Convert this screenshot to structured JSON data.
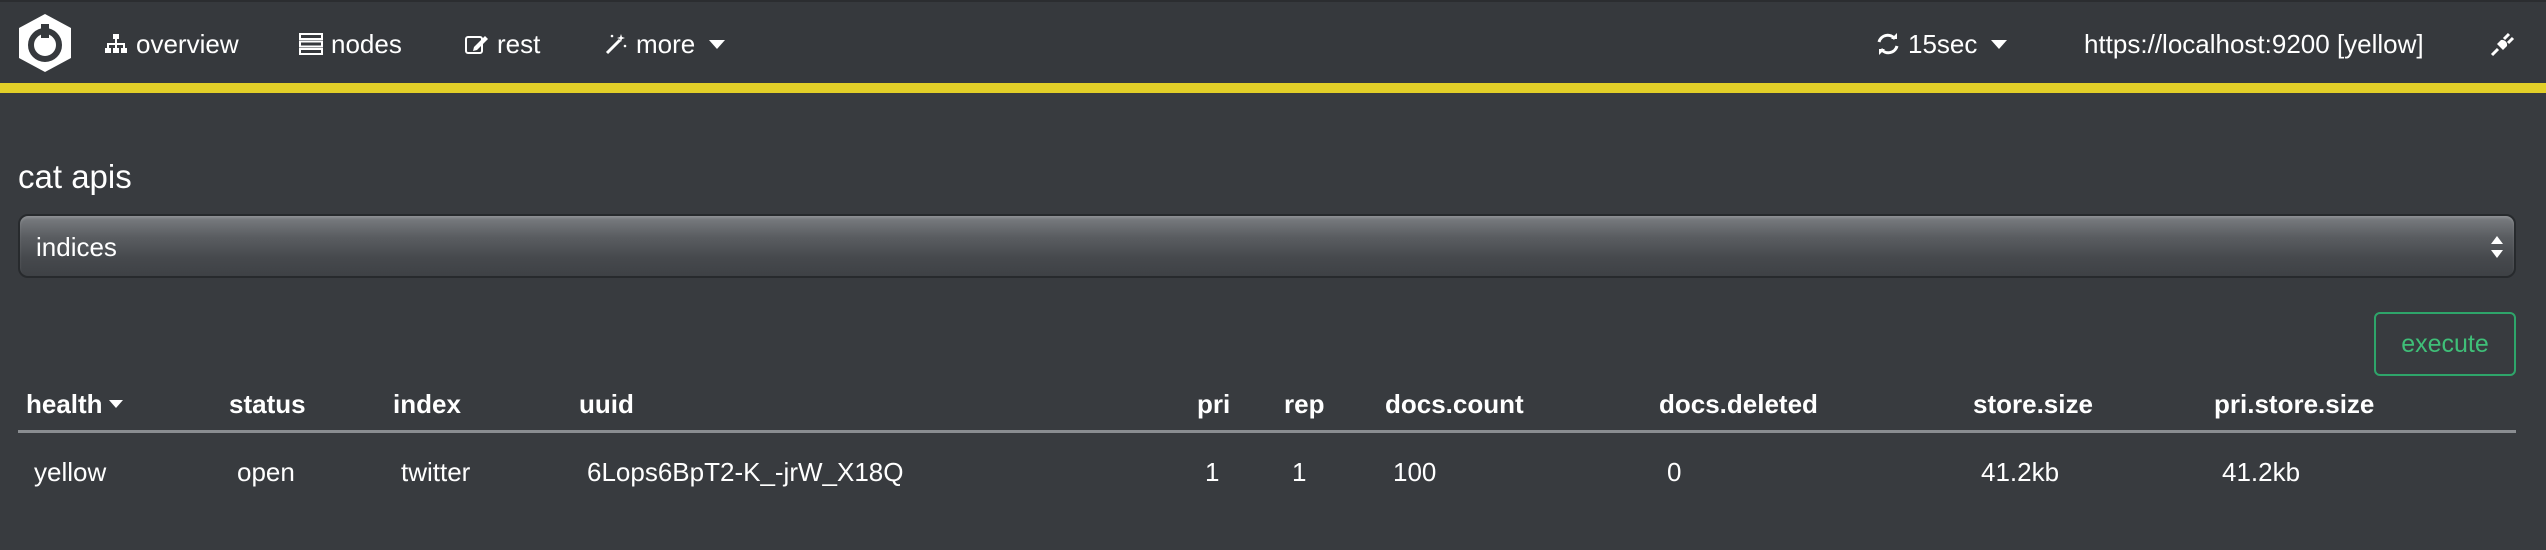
{
  "navbar": {
    "accent_color": "#e2cf28",
    "items": {
      "overview": "overview",
      "nodes": "nodes",
      "rest": "rest",
      "more": "more"
    },
    "refresh_interval": "15sec",
    "connection": "https://localhost:9200 [yellow]"
  },
  "page": {
    "title": "cat apis"
  },
  "select": {
    "value": "indices"
  },
  "execute_label": "execute",
  "table": {
    "columns": [
      "health",
      "status",
      "index",
      "uuid",
      "pri",
      "rep",
      "docs.count",
      "docs.deleted",
      "store.size",
      "pri.store.size"
    ],
    "rows": [
      [
        "yellow",
        "open",
        "twitter",
        "6Lops6BpT2-K_-jrW_X18Q",
        "1",
        "1",
        "100",
        "0",
        "41.2kb",
        "41.2kb"
      ]
    ]
  }
}
